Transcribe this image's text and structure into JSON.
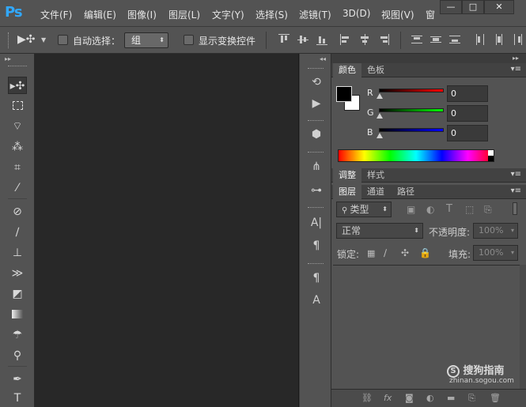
{
  "app": {
    "logo": "Ps"
  },
  "menu": {
    "items": [
      "文件(F)",
      "编辑(E)",
      "图像(I)",
      "图层(L)",
      "文字(Y)",
      "选择(S)",
      "滤镜(T)",
      "3D(D)",
      "视图(V)",
      "窗"
    ]
  },
  "window_controls": {
    "minimize": "—",
    "restore": "□",
    "close": "✕"
  },
  "options": {
    "auto_select_label": "自动选择：",
    "auto_select_value": "组",
    "show_transform_label": "显示变换控件"
  },
  "color_panel": {
    "tabs": [
      "颜色",
      "色板"
    ],
    "channels": [
      {
        "label": "R",
        "value": "0",
        "color": "#e01010"
      },
      {
        "label": "G",
        "value": "0",
        "color": "#10b010"
      },
      {
        "label": "B",
        "value": "0",
        "color": "#1010e0"
      }
    ]
  },
  "adjust_panel": {
    "tabs": [
      "调整",
      "样式"
    ]
  },
  "layers_panel": {
    "tabs": [
      "图层",
      "通道",
      "路径"
    ],
    "filter_label": "类型",
    "blend_mode": "正常",
    "opacity_label": "不透明度:",
    "opacity_value": "100%",
    "lock_label": "锁定:",
    "fill_label": "填充:",
    "fill_value": "100%"
  },
  "watermark": {
    "brand": "搜狗指南",
    "url": "zhinan.sogou.com"
  }
}
